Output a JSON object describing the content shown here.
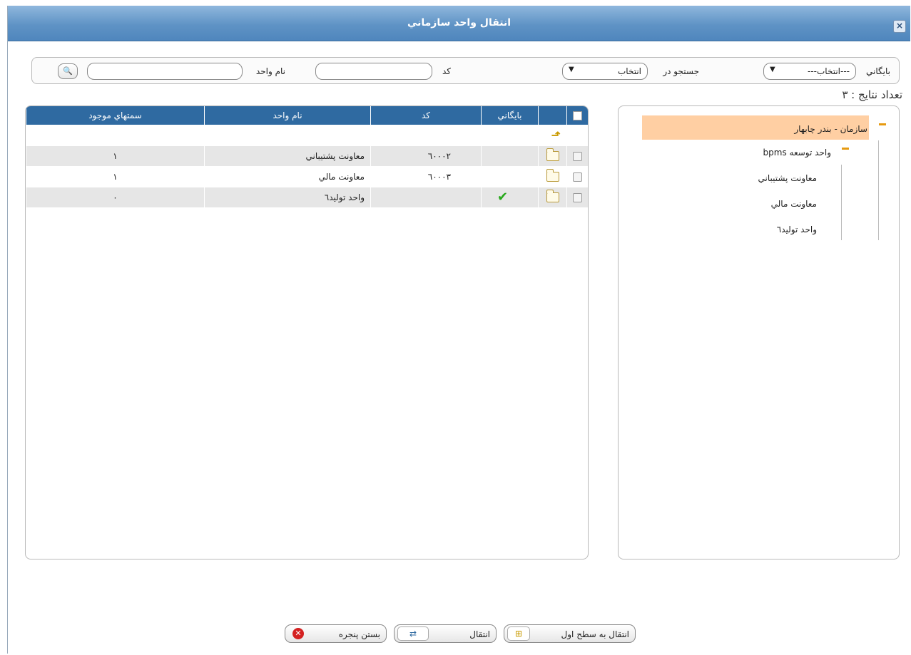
{
  "window": {
    "title": "انتقال واحد سازماني",
    "close_icon": "×"
  },
  "search": {
    "archive_label": "بايگاني",
    "archive_selected": "---انتخاب---",
    "search_in_label": "جستجو در",
    "search_in_selected": "انتخاب",
    "code_label": "كد",
    "unit_name_label": "نام واحد",
    "search_icon": "🔍"
  },
  "results_count": "تعداد نتايج : ٣",
  "tree": {
    "root": "سازمان - بندر چابهار",
    "child": "واحد توسعه bpms",
    "leaves": [
      "معاونت پشتيباني",
      "معاونت مالي",
      "واحد توليد٦"
    ]
  },
  "grid": {
    "headers": {
      "archive": "بايگاني",
      "code": "كد",
      "unit_name": "نام واحد",
      "positions": "سمتهاي موجود"
    },
    "up_icon": "⬏",
    "check_icon": "✔",
    "rows": [
      {
        "code": "٦٠٠٠٢",
        "name": "معاونت پشتيباني",
        "positions": "١"
      },
      {
        "code": "٦٠٠٠٣",
        "name": "معاونت مالي",
        "positions": "١"
      },
      {
        "code": "",
        "name": "واحد توليد٦",
        "positions": "٠"
      }
    ]
  },
  "buttons": {
    "move_top": "انتقال به سطح اول",
    "move": "انتقال",
    "close": "بستن پنجره",
    "close_icon": "✕",
    "move_icon": "⇄",
    "move_top_icon": "⊞"
  },
  "colors": {
    "header_blue": "#2f6aa1",
    "title_blue": "#5f93c5",
    "tree_highlight": "#ffcfa3",
    "minus_orange": "#e69a11"
  }
}
